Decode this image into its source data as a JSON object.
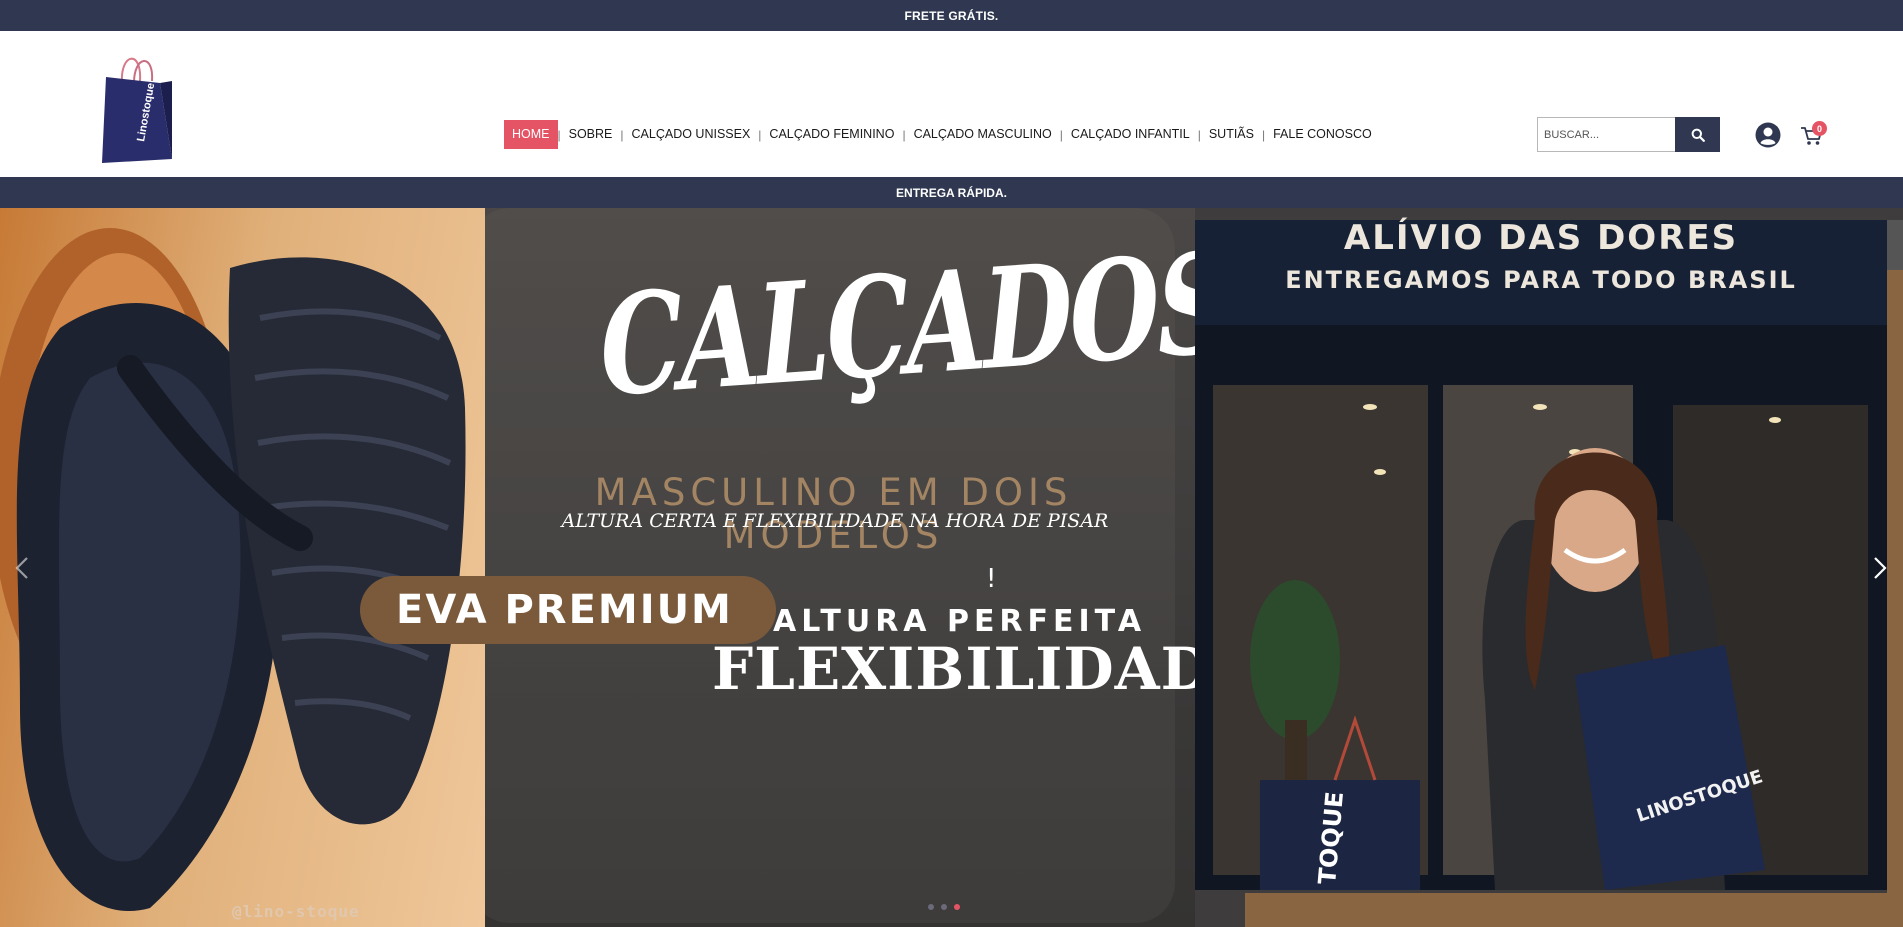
{
  "topbar": {
    "text": "FRETE GRÁTIS."
  },
  "header": {
    "logo_text": "Linostoque",
    "nav": [
      {
        "label": "HOME",
        "active": true
      },
      {
        "label": "SOBRE"
      },
      {
        "label": "CALÇADO UNISSEX"
      },
      {
        "label": "CALÇADO FEMININO"
      },
      {
        "label": "CALÇADO MASCULINO"
      },
      {
        "label": "CALÇADO INFANTIL"
      },
      {
        "label": "SUTIÃS"
      },
      {
        "label": "FALE CONOSCO"
      }
    ],
    "search": {
      "placeholder": "BUSCAR...",
      "icon": "search-icon"
    },
    "account_icon": "user-icon",
    "cart": {
      "icon": "cart-icon",
      "count": "0"
    }
  },
  "subbar": {
    "text": "ENTREGA RÁPIDA."
  },
  "banner": {
    "headline": "CALÇADOS",
    "subheadline": "MASCULINO EM DOIS MODELOS",
    "tagline": "ALTURA CERTA E FLEXIBILIDADE NA HORA DE PISAR",
    "exclamation": "!",
    "pill": "EVA PREMIUM",
    "feature1": "ALTURA PERFEITA",
    "feature2": "FLEXIBILIDADE",
    "handle": "@lino-stoque",
    "right_title1": "ALÍVIO DAS DORES",
    "right_title2": "ENTREGAMOS PARA TODO BRASIL",
    "bag_text": "LINOSTOQUE",
    "bag_text_small": "TOQUE",
    "slides": 3,
    "active_slide": 3
  },
  "colors": {
    "navy": "#2f3850",
    "accent": "#e55465",
    "tan": "#8a6541"
  }
}
